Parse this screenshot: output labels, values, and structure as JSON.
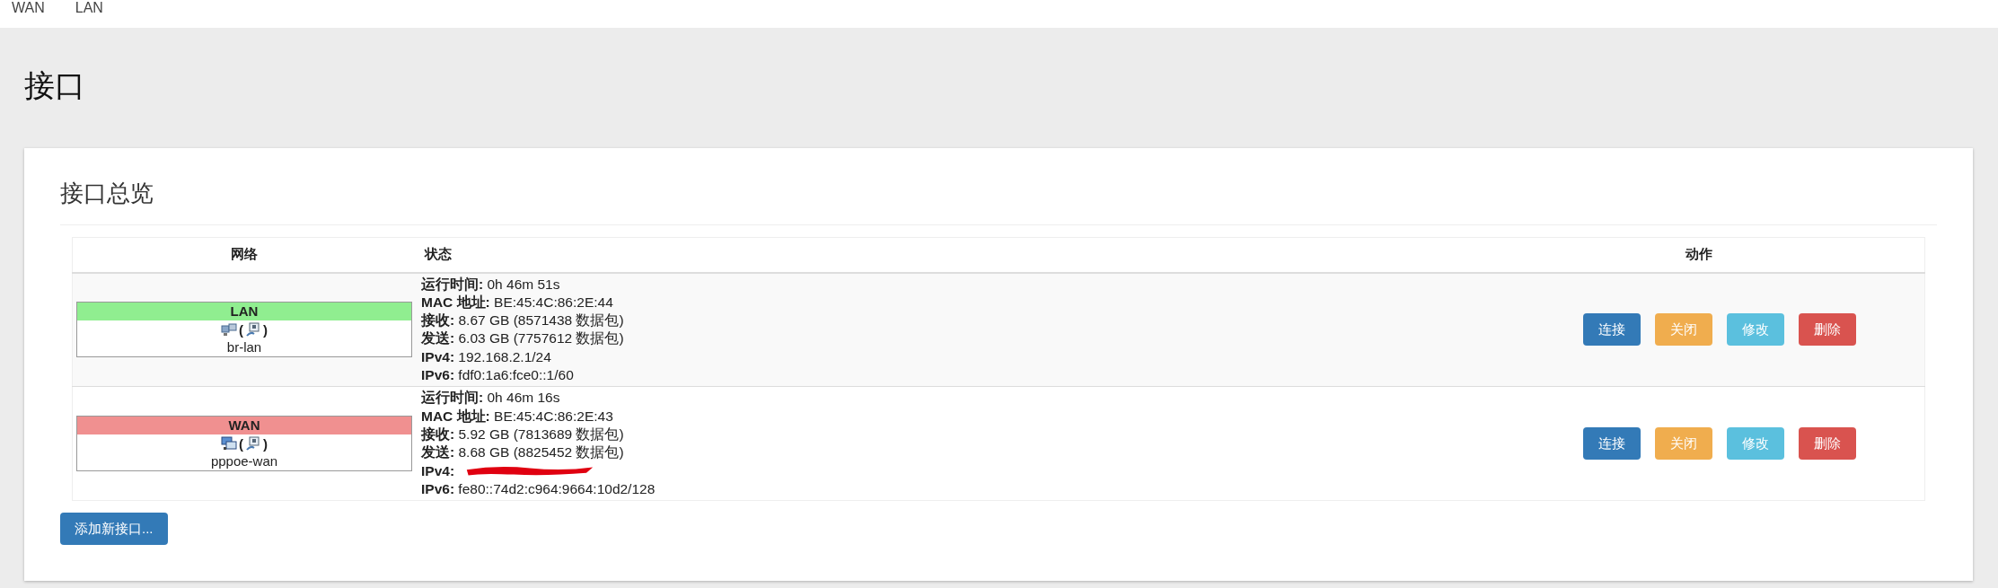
{
  "nav": [
    {
      "label": "WAN"
    },
    {
      "label": "LAN"
    }
  ],
  "page_title": "接口",
  "section": {
    "title": "接口总览",
    "table": {
      "columns": [
        "网络",
        "状态",
        "动作"
      ],
      "rows": [
        {
          "network": {
            "name": "LAN",
            "color": "#90ee90",
            "device": "br-lan",
            "kind": "bridge",
            "open_paren": "(",
            "close_paren": ")"
          },
          "status": [
            "**运行时间:** 0h 46m 51s",
            "**MAC 地址:** BE:45:4C:86:2E:44",
            "**接收:** 8.67 GB (8571438 数据包)",
            "**发送:** 6.03 GB (7757612 数据包)",
            "**IPv4:** 192.168.2.1/24",
            "**IPv6:** fdf0:1a6:fce0::1/60"
          ],
          "actions": [
            {
              "label": "连接",
              "kind": "primary"
            },
            {
              "label": "关闭",
              "kind": "warning"
            },
            {
              "label": "修改",
              "kind": "info"
            },
            {
              "label": "删除",
              "kind": "danger"
            }
          ]
        },
        {
          "network": {
            "name": "WAN",
            "color": "#f09090",
            "device": "pppoe-wan",
            "kind": "pppoe",
            "open_paren": "(",
            "close_paren": ")"
          },
          "status": [
            "**运行时间:** 0h 46m 16s",
            "**MAC 地址:** BE:45:4C:86:2E:43",
            "**接收:** 5.92 GB (7813689 数据包)",
            "**发送:** 8.68 GB (8825452 数据包)",
            {
              "label": "IPv4:",
              "redacted": true
            },
            "**IPv6:** fe80::74d2:c964:9664:10d2/128"
          ],
          "actions": [
            {
              "label": "连接",
              "kind": "primary"
            },
            {
              "label": "关闭",
              "kind": "warning"
            },
            {
              "label": "修改",
              "kind": "info"
            },
            {
              "label": "删除",
              "kind": "danger"
            }
          ]
        }
      ]
    },
    "add_button": "添加新接口..."
  }
}
